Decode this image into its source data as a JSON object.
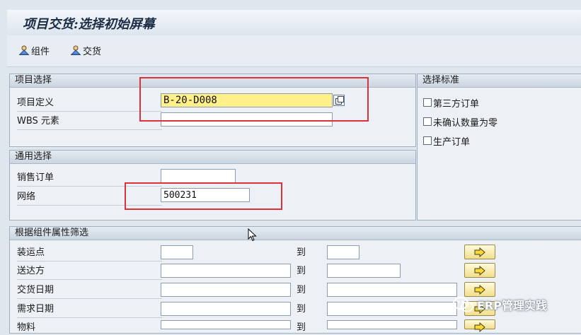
{
  "title": "项目交货:选择初始屏幕",
  "toolbar": {
    "components_label": "组件",
    "delivery_label": "交货"
  },
  "project_selection": {
    "header": "项目选择",
    "project_definition_label": "项目定义",
    "project_definition_value": "B-20-D008",
    "wbs_label": "WBS 元素",
    "wbs_value": ""
  },
  "selection_criteria": {
    "header": "选择标准",
    "options": [
      {
        "label": "第三方订单",
        "checked": false
      },
      {
        "label": "未确认数量为零",
        "checked": false
      },
      {
        "label": "生产订单",
        "checked": false
      }
    ]
  },
  "general_selection": {
    "header": "通用选择",
    "sales_order_label": "销售订单",
    "sales_order_value": "",
    "network_label": "网络",
    "network_value": "500231"
  },
  "component_filter": {
    "header": "根据组件属性筛选",
    "to_label": "到",
    "rows": [
      {
        "label": "装运点",
        "from": "",
        "to": ""
      },
      {
        "label": "送达方",
        "from": "",
        "to": ""
      },
      {
        "label": "交货日期",
        "from": "",
        "to": ""
      },
      {
        "label": "需求日期",
        "from": "",
        "to": ""
      },
      {
        "label": "物料",
        "from": "",
        "to": ""
      }
    ]
  },
  "watermark": "ERP管理实践",
  "colors": {
    "highlight_red": "#e0303a",
    "input_yellow": "#fff08a"
  }
}
